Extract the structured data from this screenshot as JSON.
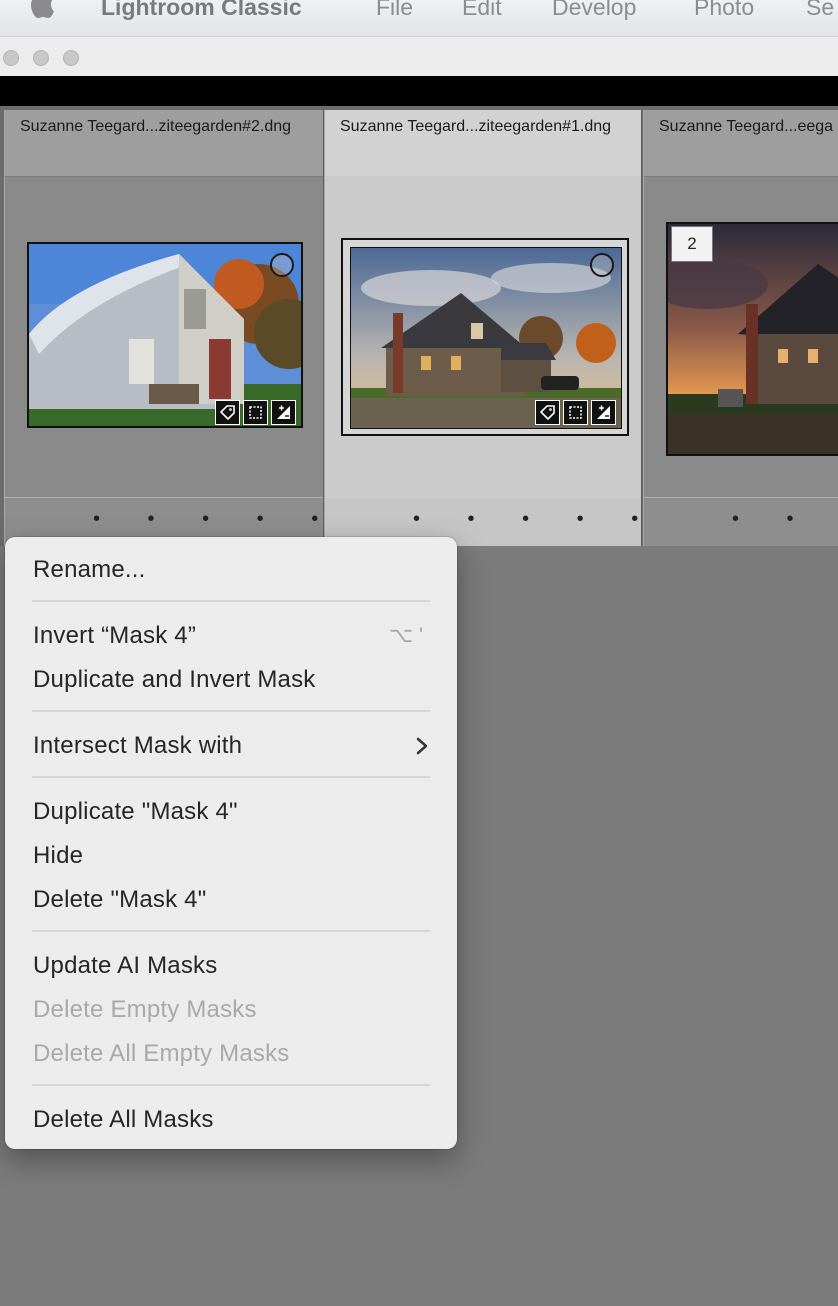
{
  "menubar": {
    "app_name": "Lightroom Classic",
    "items": [
      "File",
      "Edit",
      "Develop",
      "Photo",
      "Se"
    ]
  },
  "filmstrip": {
    "cells": [
      {
        "filename": "Suzanne Teegard...ziteegarden#2.dng",
        "dots": "• • • • •"
      },
      {
        "filename": "Suzanne Teegard...ziteegarden#1.dng",
        "dots": "• • • • •"
      },
      {
        "filename": "Suzanne Teegard...eega",
        "dots": "• • • •",
        "stack_count": "2"
      }
    ]
  },
  "context_menu": {
    "rename": "Rename...",
    "invert": "Invert “Mask 4”",
    "invert_shortcut": "⌥ '",
    "duplicate_invert": "Duplicate and Invert Mask",
    "intersect": "Intersect Mask with",
    "duplicate": "Duplicate \"Mask 4\"",
    "hide": "Hide",
    "delete": "Delete \"Mask 4\"",
    "update_ai": "Update AI Masks",
    "delete_empty": "Delete Empty Masks",
    "delete_all_empty": "Delete All Empty Masks",
    "delete_all": "Delete All Masks"
  }
}
